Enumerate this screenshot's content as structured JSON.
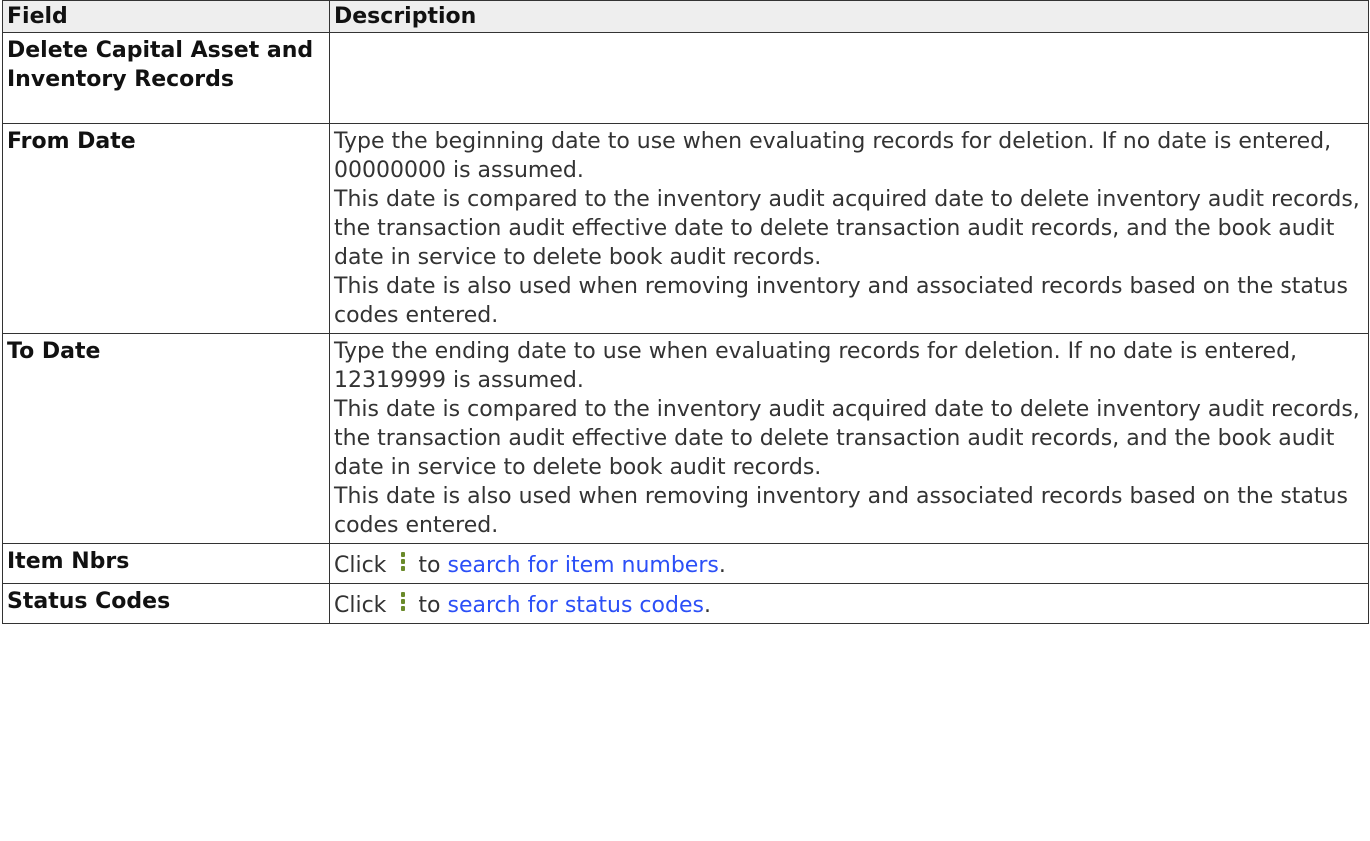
{
  "table": {
    "headers": [
      "Field",
      "Description"
    ],
    "rows": [
      {
        "field": "Delete Capital Asset and Inventory Records",
        "lines": []
      },
      {
        "field": "From Date",
        "lines": [
          "Type the beginning date to use when evaluating records for deletion. If no date is entered, 00000000 is assumed.",
          "This date is compared to the inventory audit acquired date to delete inventory audit records, the transaction audit effective date to delete transaction audit records, and the book audit date in service to delete book audit records.",
          "This date is also used when removing inventory and associated records based on the status codes entered."
        ]
      },
      {
        "field": "To Date",
        "lines": [
          "Type the ending date to use when evaluating records for deletion. If no date is entered, 12319999 is assumed.",
          "This date is compared to the inventory audit acquired date to delete inventory audit records, the transaction audit effective date to delete transaction audit records, and the book audit date in service to delete book audit records.",
          "This date is also used when removing inventory and associated records based on the status codes entered."
        ]
      },
      {
        "field": "Item Nbrs",
        "click": "Click",
        "to": "to",
        "link": "search for item numbers",
        "end": "."
      },
      {
        "field": "Status Codes",
        "click": "Click",
        "to": "to",
        "link": "search for status codes",
        "end": "."
      }
    ]
  },
  "icons": {
    "lookup": "vertical-dots-icon"
  },
  "colors": {
    "link": "#2b4ff7",
    "icon": "#6a8a2a",
    "header_bg": "#eeeeee"
  }
}
